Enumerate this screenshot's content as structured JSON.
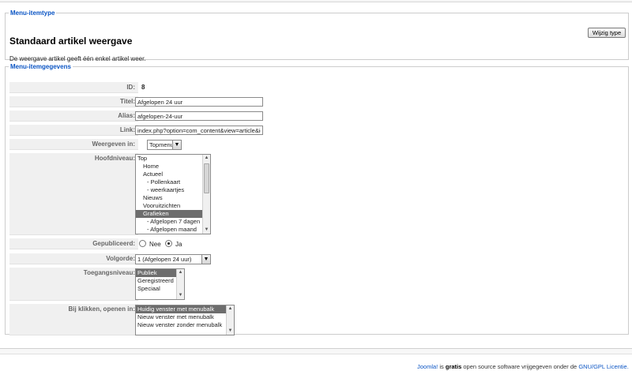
{
  "menu_item_type": {
    "legend": "Menu-itemtype",
    "title": "Standaard artikel weergave",
    "description": "De weergave artikel geeft één enkel artikel weer.",
    "change_type_button": "Wijzig type"
  },
  "details": {
    "legend": "Menu-itemgegevens",
    "id_label": "ID:",
    "id_value": "8",
    "title_label": "Titel:",
    "title_value": "Afgelopen 24 uur",
    "alias_label": "Alias:",
    "alias_value": "afgelopen-24-uur",
    "link_label": "Link:",
    "link_value": "index.php?option=com_content&view=article&id",
    "show_in_label": "Weergeven in:",
    "show_in_value": "Topmenu",
    "parent_label": "Hoofdniveau:",
    "parent_options": [
      "Top",
      "Home",
      "Actueel",
      "- Pollenkaart",
      "- weerkaartjes",
      "Nieuws",
      "Vooruitzichten",
      "Grafieken",
      "- Afgelopen 7 dagen",
      "- Afgelopen maand"
    ],
    "parent_selected": "Grafieken",
    "published_label": "Gepubliceerd:",
    "published_no": "Nee",
    "published_yes": "Ja",
    "published_value": "Ja",
    "order_label": "Volgorde:",
    "order_value": "1 (Afgelopen 24 uur)",
    "access_label": "Toegangsniveau:",
    "access_options": [
      "Publiek",
      "Geregistreerd",
      "Speciaal"
    ],
    "access_selected": "Publiek",
    "on_click_label": "Bij klikken, openen in:",
    "on_click_options": [
      "Huidig venster met menubalk",
      "Nieuw venster met menubalk",
      "Nieuw venster zonder menubalk"
    ],
    "on_click_selected": "Huidig venster met menubalk"
  },
  "footer": {
    "joomla_link": "Joomla!",
    "is": " is ",
    "gratis": "gratis",
    "text": " open source software vrijgegeven onder de ",
    "license_link": "GNU/GPL Licentie."
  }
}
